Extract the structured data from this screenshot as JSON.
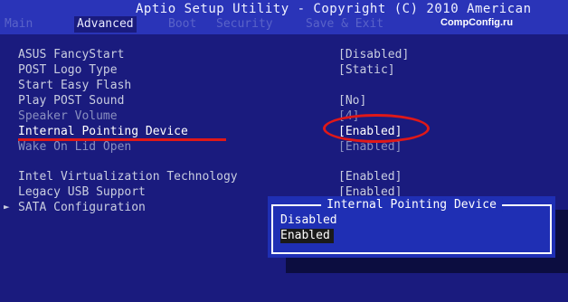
{
  "header": {
    "title": "Aptio Setup Utility - Copyright (C) 2010 American",
    "watermark": "CompConfig.ru",
    "tabs": [
      "Main",
      "Advanced",
      "Boot",
      "Security",
      "Save & Exit"
    ],
    "active_tab": "Advanced"
  },
  "settings": [
    {
      "label": "ASUS FancyStart",
      "value": "[Disabled]"
    },
    {
      "label": "POST Logo Type",
      "value": "[Static]"
    },
    {
      "label": "Start Easy Flash",
      "value": ""
    },
    {
      "label": "Play POST Sound",
      "value": "[No]"
    },
    {
      "label": "Speaker Volume",
      "value": "[4]"
    },
    {
      "label": "Internal Pointing Device",
      "value": "[Enabled]"
    },
    {
      "label": "Wake On Lid Open",
      "value": "[Enabled]"
    },
    {
      "label": "Intel Virtualization Technology",
      "value": "[Enabled]"
    },
    {
      "label": "Legacy USB Support",
      "value": "[Enabled]"
    },
    {
      "label": "SATA Configuration",
      "value": ""
    }
  ],
  "submenu_marker": "►",
  "popup": {
    "title": "Internal Pointing Device",
    "options": [
      "Disabled",
      "Enabled"
    ],
    "selected": "Enabled"
  },
  "colors": {
    "background": "#1a1b7e",
    "titlebar": "#2a34b8",
    "annotation_red": "#e01818",
    "popup_bg": "#1f2fb4"
  }
}
